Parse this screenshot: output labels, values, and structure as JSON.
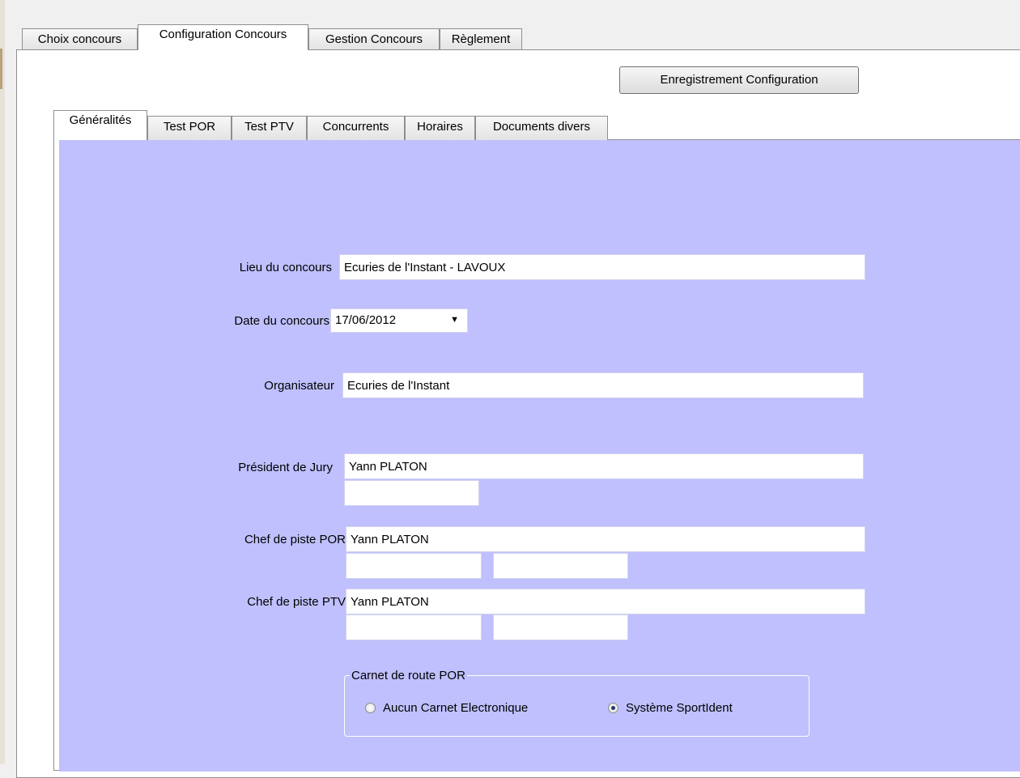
{
  "main_tabs": [
    {
      "label": "Choix concours",
      "active": false
    },
    {
      "label": "Configuration Concours",
      "active": true
    },
    {
      "label": "Gestion Concours",
      "active": false
    },
    {
      "label": "Règlement",
      "active": false
    }
  ],
  "toolbar": {
    "save_label": "Enregistrement Configuration"
  },
  "sub_tabs": [
    {
      "label": "Généralités",
      "active": true
    },
    {
      "label": "Test POR",
      "active": false
    },
    {
      "label": "Test PTV",
      "active": false
    },
    {
      "label": "Concurrents",
      "active": false
    },
    {
      "label": "Horaires",
      "active": false
    },
    {
      "label": "Documents divers",
      "active": false
    }
  ],
  "form": {
    "lieu": {
      "label": "Lieu du concours",
      "value": "Ecuries de l'Instant - LAVOUX"
    },
    "date": {
      "label": "Date du concours",
      "value": "17/06/2012",
      "arrow": "▼"
    },
    "organisateur": {
      "label": "Organisateur",
      "value": "Ecuries de l'Instant"
    },
    "president": {
      "label": "Président de Jury",
      "value": "Yann PLATON",
      "extra": ""
    },
    "chef_por": {
      "label": "Chef de piste POR",
      "value": "Yann PLATON",
      "extra1": "",
      "extra2": ""
    },
    "chef_ptv": {
      "label": "Chef de piste PTV",
      "value": "Yann PLATON",
      "extra1": "",
      "extra2": ""
    }
  },
  "carnet": {
    "legend": "Carnet de route POR",
    "options": [
      {
        "label": "Aucun Carnet Electronique",
        "checked": false
      },
      {
        "label": "Système SportIdent",
        "checked": true
      }
    ]
  },
  "colors": {
    "panel_background": "#c0c0fe",
    "window_background": "#f0f0f0"
  }
}
